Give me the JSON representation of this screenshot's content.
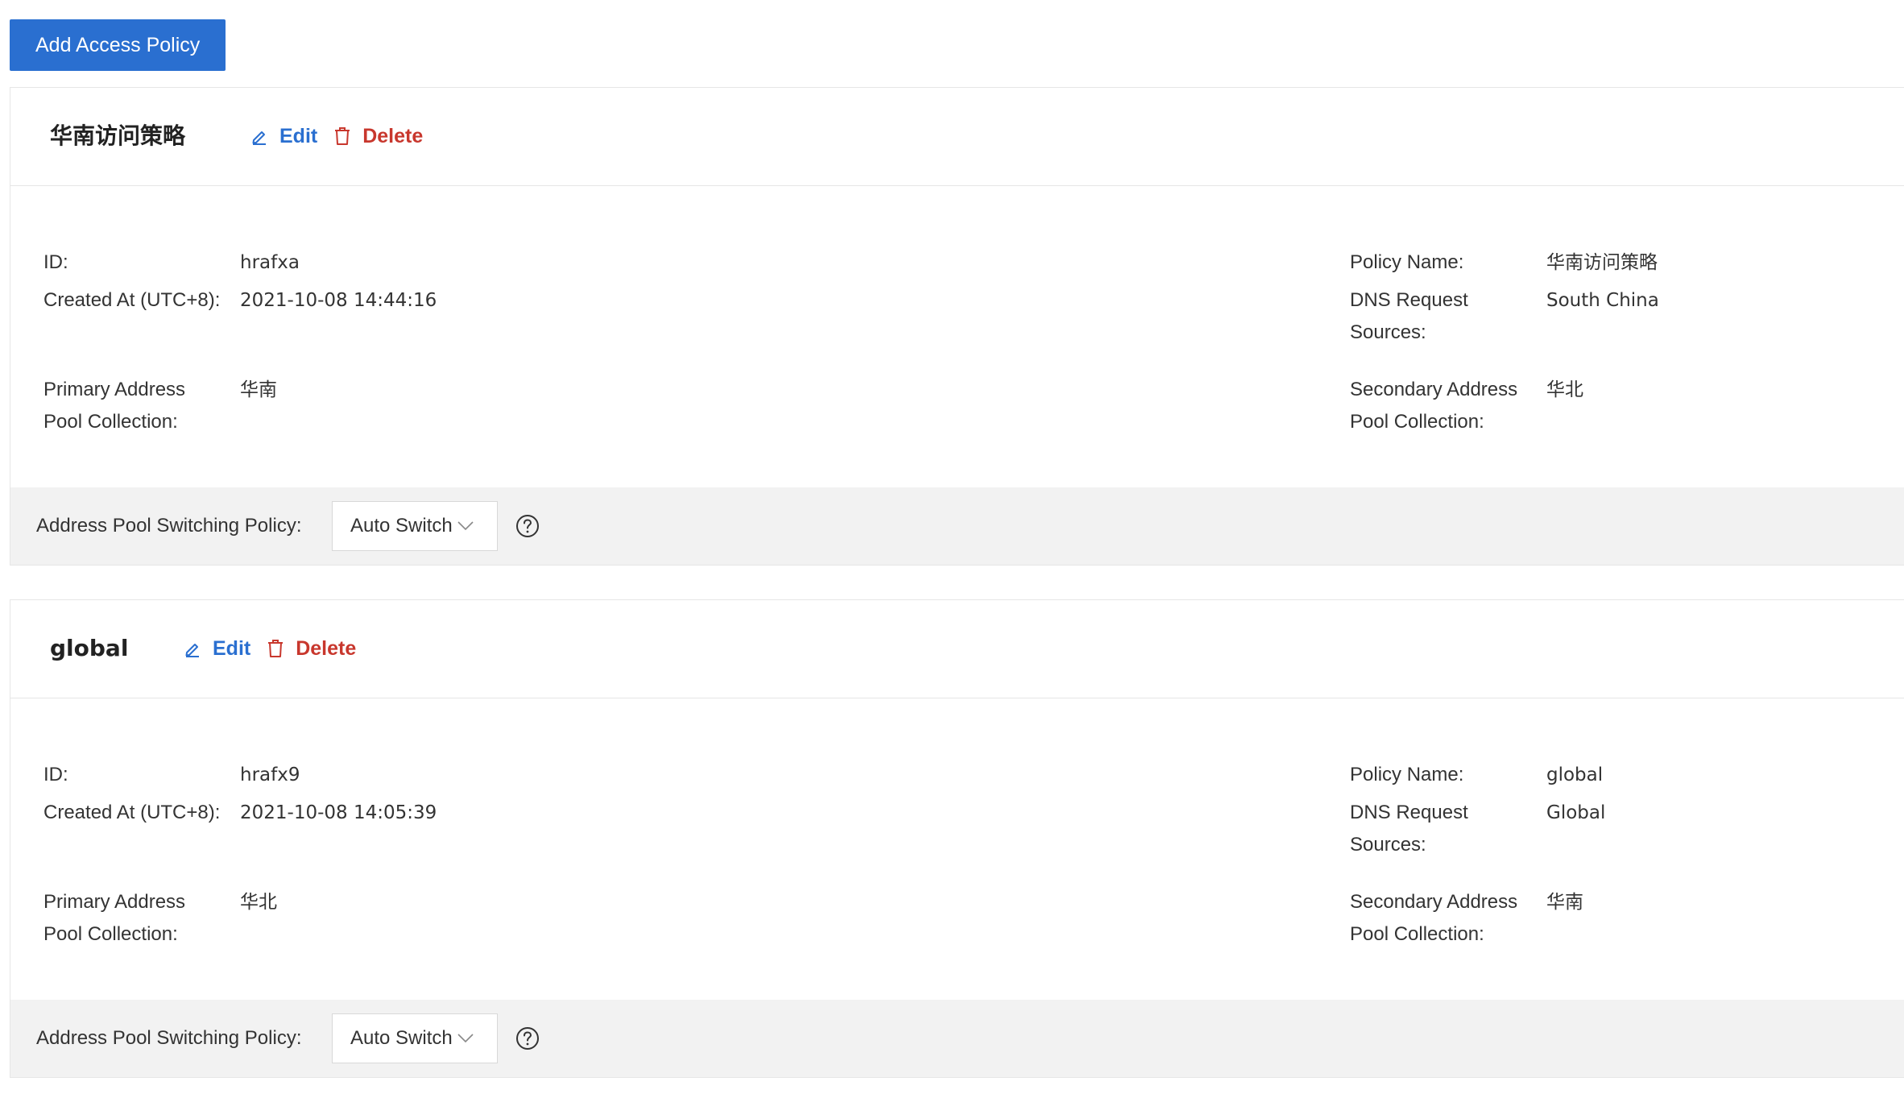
{
  "toolbar": {
    "add_label": "Add Access Policy"
  },
  "labels": {
    "edit": "Edit",
    "delete": "Delete",
    "id": "ID:",
    "created_at": "Created At (UTC+8):",
    "primary_pool_1": "Primary Address",
    "primary_pool_2": "Pool Collection:",
    "policy_name": "Policy Name:",
    "dns_sources_1": "DNS Request",
    "dns_sources_2": "Sources:",
    "secondary_pool_1": "Secondary Address",
    "secondary_pool_2": "Pool Collection:",
    "switching_policy": "Address Pool Switching Policy:"
  },
  "policies": [
    {
      "title": "华南访问策略",
      "id": "hrafxa",
      "created_at": "2021-10-08 14:44:16",
      "primary_pool": "华南",
      "policy_name": "华南访问策略",
      "dns_sources": "South China",
      "secondary_pool": "华北",
      "switching_policy": "Auto Switch"
    },
    {
      "title": "global",
      "id": "hrafx9",
      "created_at": "2021-10-08 14:05:39",
      "primary_pool": "华北",
      "policy_name": "global",
      "dns_sources": "Global",
      "secondary_pool": "华南",
      "switching_policy": "Auto Switch"
    }
  ],
  "colors": {
    "primary": "#2a6fd0",
    "danger": "#c8372d",
    "footer_bg": "#f2f2f2"
  },
  "icons": {
    "edit": "edit-icon",
    "delete": "trash-icon",
    "help": "help-circle-icon",
    "chevron": "chevron-down-icon"
  }
}
